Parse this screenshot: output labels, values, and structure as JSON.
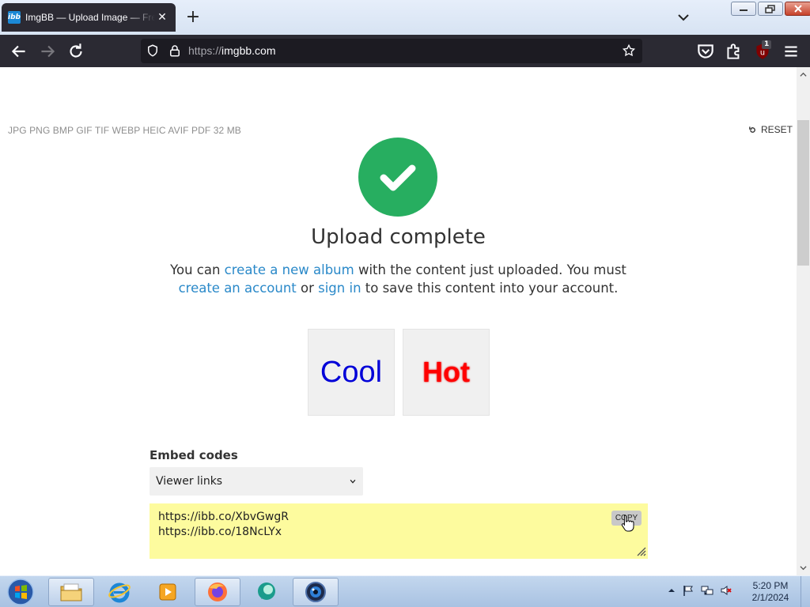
{
  "browser": {
    "tab_title": "ImgBB — Upload Image — Free Image Hosting",
    "favicon_text": "ibb",
    "url_scheme": "https://",
    "url_host": "imgbb.com",
    "extension_badge": "1"
  },
  "page": {
    "formats": "JPG PNG BMP GIF TIF WEBP HEIC AVIF PDF  32 MB",
    "reset_label": "RESET",
    "headline": "Upload complete",
    "message": {
      "p1": "You can ",
      "link_album": "create a new album",
      "p2": " with the content just uploaded. You must ",
      "link_account": "create an account",
      "p3": " or ",
      "link_signin": "sign in",
      "p4": " to save this content into your account."
    },
    "thumbnails": [
      "Cool",
      "Hot"
    ],
    "embed": {
      "label": "Embed codes",
      "selected_option": "Viewer links",
      "links": [
        "https://ibb.co/XbvGwgR",
        "https://ibb.co/18NcLYx"
      ],
      "copy_label": "COPY"
    }
  },
  "taskbar": {
    "time": "5:20 PM",
    "date": "2/1/2024"
  },
  "colors": {
    "success": "#27ae60",
    "link": "#2a89c9",
    "codebox": "#fdfb9e"
  }
}
